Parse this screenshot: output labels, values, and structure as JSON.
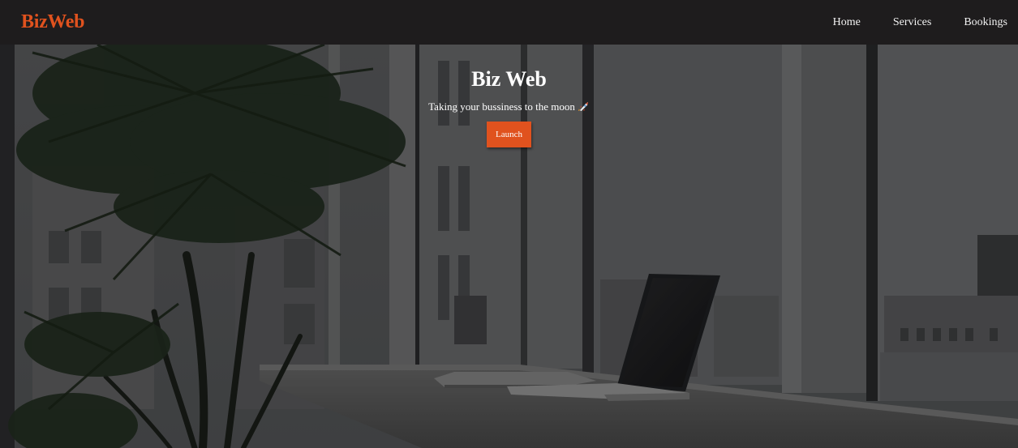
{
  "navbar": {
    "brand": "BizWeb",
    "links": [
      {
        "label": "Home"
      },
      {
        "label": "Services"
      },
      {
        "label": "Bookings"
      }
    ]
  },
  "hero": {
    "title": "Biz Web",
    "subtitle": "Taking your bussiness to the moon",
    "subtitle_icon": "rocket-icon",
    "button_label": "Launch",
    "background": "dimmed office photo with palm plant, window and laptop on desk"
  },
  "colors": {
    "accent": "#e0521e",
    "navbar_bg": "#1e1c1d",
    "text": "#ffffff"
  }
}
